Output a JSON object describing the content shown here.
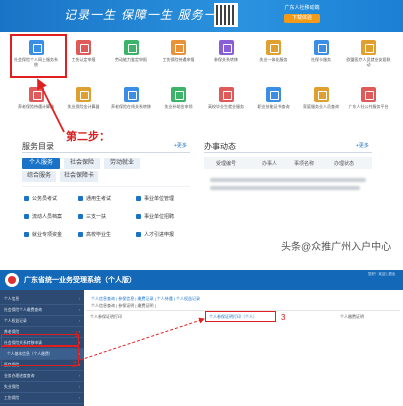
{
  "banner": {
    "slogan": "记录一生  保障一生  服务一生",
    "app_title": "广东人社移动端",
    "app_download": "下载体验"
  },
  "icons": [
    {
      "label": "社会保险个人网上服务系统",
      "color": "#3a8ee6"
    },
    {
      "label": "工伤认定申报",
      "color": "#e05a5a"
    },
    {
      "label": "劳动能力鉴定申报",
      "color": "#3db36a"
    },
    {
      "label": "工伤保险待遇申报",
      "color": "#e8923a"
    },
    {
      "label": "参保关系转移",
      "color": "#8a5fd6"
    },
    {
      "label": "失业一体化服务",
      "color": "#e0a030"
    },
    {
      "label": "社保卡服务",
      "color": "#3a8ee6"
    },
    {
      "label": "欧盟医疗人员就业安居联动",
      "color": "#e0a030"
    },
    {
      "label": "养老保险待遇计算器",
      "color": "#e05a5a"
    },
    {
      "label": "失业保险金计算器",
      "color": "#e0a030"
    },
    {
      "label": "养老保险在线关系转移",
      "color": "#3a8ee6"
    },
    {
      "label": "失业补助金申领",
      "color": "#3db36a"
    },
    {
      "label": "高校毕业生就业服务",
      "color": "#e05a5a"
    },
    {
      "label": "职业技能证书查询",
      "color": "#3a8ee6"
    },
    {
      "label": "家庭服务业人员查询",
      "color": "#e0a030"
    },
    {
      "label": "广东人社公共服务平台",
      "color": "#e05a5a"
    }
  ],
  "step_label": "第二步：",
  "services": {
    "title": "服务目录",
    "more": "+更多",
    "tabs": [
      {
        "label": "个人服务",
        "active": true
      },
      {
        "label": "社会保险",
        "active": false
      },
      {
        "label": "劳动就业",
        "active": false
      },
      {
        "label": "综合服务",
        "active": false
      },
      {
        "label": "社会保障卡",
        "active": false
      }
    ],
    "items": [
      "公务员考试",
      "通用生考试",
      "事业单位管理",
      "流动人员档案",
      "三支一扶",
      "事业单位招聘",
      "就业专项资金",
      "高校毕业生",
      "人才引进申报"
    ]
  },
  "todo": {
    "title": "办事动态",
    "more": "+更多",
    "columns": [
      "受理编号",
      "办事人",
      "事项名称",
      "办理状态"
    ]
  },
  "watermark": "头条@众推广州入户中心",
  "bottom": {
    "system_title": "广东省统一业务受理系统（个人版）",
    "user_info": "您好！欢迎 | 退出",
    "sidebar": [
      {
        "label": "个人信息",
        "sub": false
      },
      {
        "label": "社会保险个人缴费查询",
        "sub": false
      },
      {
        "label": "个人权益记录",
        "sub": false
      },
      {
        "label": "养老保险",
        "sub": false
      },
      {
        "label": "社会保险关系转移申请",
        "sub": false
      },
      {
        "label": "个人基本信息（个人缴费）",
        "sub": true
      },
      {
        "label": "医疗保险",
        "sub": false
      },
      {
        "label": "业务办理进度查询",
        "sub": false
      },
      {
        "label": "失业保险",
        "sub": false
      },
      {
        "label": "工伤保险",
        "sub": false
      }
    ],
    "breadcrumb1": "个人信息查询  |  参保信息  |  缴费记录  |  个人待遇  |  个人权益记录",
    "breadcrumb2": "个人信息查询  |  参保证明  |  缴费证明  |",
    "row": {
      "left": "个人参保证明打印",
      "link": "个人参保证明打印（个人）",
      "right": "个人缴费证明"
    },
    "numbers": [
      "1",
      "2",
      "3"
    ]
  }
}
